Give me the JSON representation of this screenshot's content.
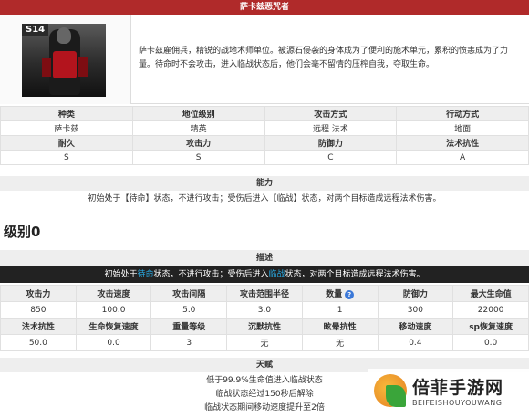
{
  "header": {
    "title": "萨卡兹恶咒者"
  },
  "profile": {
    "badge": "S14",
    "description": "萨卡兹雇佣兵，精锐的战地术师单位。被源石侵袭的身体成为了便利的施术单元，累积的愤恚成为了力量。待命时不会攻击，进入临战状态后，他们会毫不留情的压榨自我，夺取生命。"
  },
  "info_table": {
    "row1_headers": [
      "种类",
      "地位级别",
      "攻击方式",
      "行动方式"
    ],
    "row1_values": [
      "萨卡兹",
      "精英",
      "远程 法术",
      "地面"
    ],
    "row2_headers": [
      "耐久",
      "攻击力",
      "防御力",
      "法术抗性"
    ],
    "row2_values": [
      "S",
      "S",
      "C",
      "A"
    ]
  },
  "ability": {
    "title": "能力",
    "text": "初始处于【待命】状态，不进行攻击；受伤后进入【临战】状态，对两个目标造成远程法术伤害。"
  },
  "level": {
    "title": "级别0"
  },
  "description_section": {
    "title": "描述",
    "p1": "初始处于",
    "k1": "待命",
    "p2": "状态，不进行攻击；受伤后进入",
    "k2": "临战",
    "p3": "状态，对两个目标造成远程法术伤害。"
  },
  "stats": {
    "headers1": [
      "攻击力",
      "攻击速度",
      "攻击间隔",
      "攻击范围半径",
      "数量",
      "防御力",
      "最大生命值"
    ],
    "values1": [
      "850",
      "100.0",
      "5.0",
      "3.0",
      "1",
      "300",
      "22000"
    ],
    "headers2": [
      "法术抗性",
      "生命恢复速度",
      "重量等级",
      "沉默抗性",
      "眩晕抗性",
      "移动速度",
      "sp恢复速度"
    ],
    "values2": [
      "50.0",
      "0.0",
      "3",
      "无",
      "无",
      "0.4",
      "0.0"
    ],
    "help_icon": "?"
  },
  "talent": {
    "title": "天赋",
    "lines": [
      "低于99.9%生命值进入临战状态",
      "临战状态经过150秒后解除",
      "临战状态期间移动速度提升至2倍"
    ]
  },
  "watermark": {
    "name": "倍菲手游网",
    "sub": "BEIFEISHOUYOUWANG"
  },
  "colors": {
    "header_red": "#b02a2a",
    "keyword_blue": "#29a8e0",
    "dark_bar": "#222222"
  }
}
